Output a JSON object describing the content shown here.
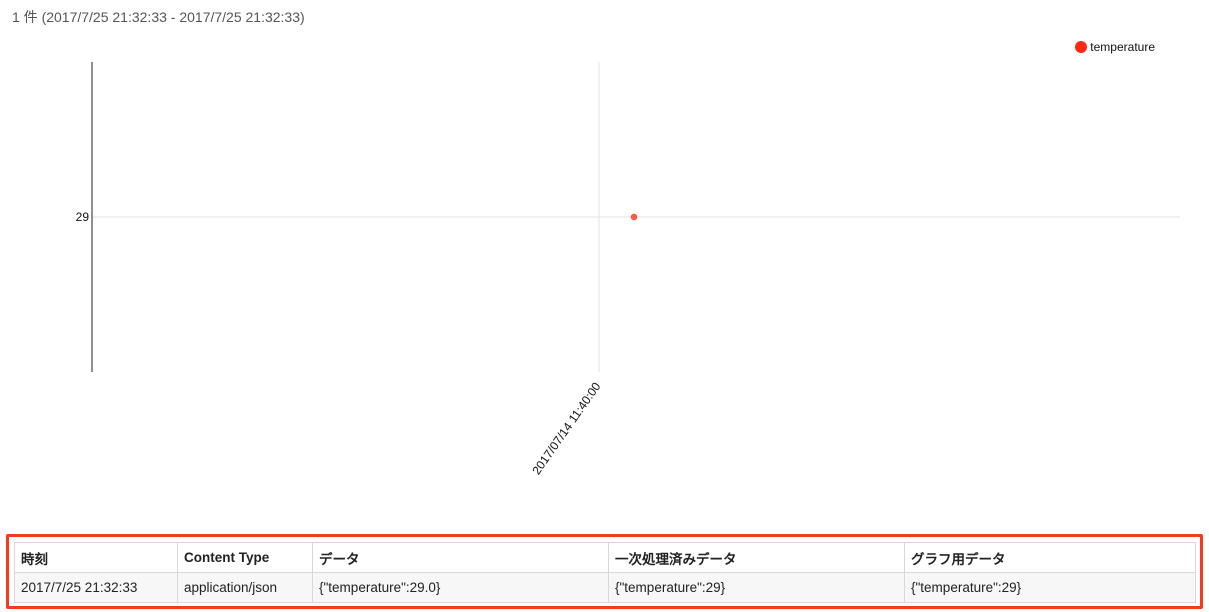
{
  "summary": {
    "text": "1 件 (2017/7/25 21:32:33 - 2017/7/25 21:32:33)"
  },
  "legend": {
    "label": "temperature",
    "color": "#ff2a12"
  },
  "chart_data": {
    "type": "scatter",
    "series": [
      {
        "name": "temperature",
        "color": "#ff2a12",
        "points": [
          {
            "x": "2017-07-14 11:45:00",
            "y": 29
          }
        ]
      }
    ],
    "x_tick_labels": [
      "2017/07/14 11:40:00"
    ],
    "y_tick_labels": [
      "29"
    ],
    "grid": true,
    "legend": "top-right"
  },
  "table": {
    "headers": [
      "時刻",
      "Content Type",
      "データ",
      "一次処理済みデータ",
      "グラフ用データ"
    ],
    "rows": [
      [
        "2017/7/25 21:32:33",
        "application/json",
        "{\"temperature\":29.0}",
        "{\"temperature\":29}",
        "{\"temperature\":29}"
      ]
    ],
    "highlight_color": "#f53b1c"
  }
}
